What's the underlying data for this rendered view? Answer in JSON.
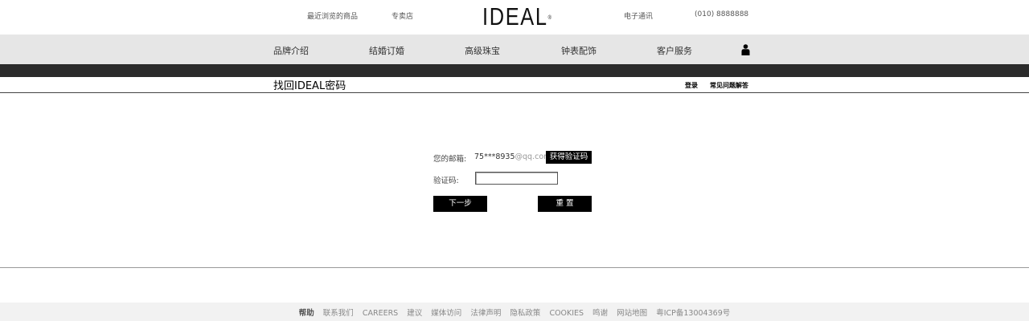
{
  "header": {
    "recent_label": "最近浏览的商品",
    "store_label": "专卖店",
    "logo_text": "IDEAL",
    "logo_mark": "®",
    "newsletter_label": "电子通讯",
    "phone": "(010)  8888888"
  },
  "nav": {
    "items": [
      "品牌介绍",
      "结婚订婚",
      "高级珠宝",
      "钟表配饰",
      "客户服务"
    ],
    "account_icon": "user-icon"
  },
  "page": {
    "title": "找回IDEAL密码",
    "login_link": "登录",
    "faq_link": "常见问题解答"
  },
  "form": {
    "email_label": "您的邮箱:",
    "email_user": "75***8935",
    "email_domain": "@qq.com",
    "get_code_button": "获得验证码",
    "code_label": "验证码:",
    "code_value": "",
    "next_button": "下一步",
    "reset_button": "重 置"
  },
  "footer": {
    "help": "帮助",
    "links": [
      "联系我们",
      "CAREERS",
      "建议",
      "媒体访问",
      "法律声明",
      "隐私政策",
      "COOKIES",
      "鸣谢",
      "网站地图"
    ],
    "icp": "粤ICP备13004369号"
  },
  "colors": {
    "nav_bg": "#e6e6e6",
    "dark_bar": "#2b2b2b",
    "button_bg": "#000000",
    "footer_bg": "#f2f2f2"
  }
}
